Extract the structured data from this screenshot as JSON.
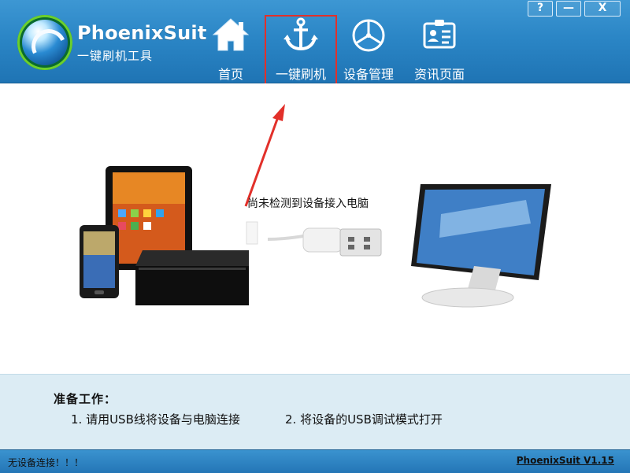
{
  "window": {
    "buttons": {
      "help": "?",
      "minimize": "—",
      "close": "X"
    }
  },
  "brand": {
    "name": "PhoenixSuit",
    "subtitle": "一键刷机工具"
  },
  "nav": [
    {
      "label": "首页",
      "icon": "home-icon"
    },
    {
      "label": "一键刷机",
      "icon": "anchor-icon",
      "selected": true
    },
    {
      "label": "设备管理",
      "icon": "aperture-icon"
    },
    {
      "label": "资讯页面",
      "icon": "id-card-icon"
    }
  ],
  "main": {
    "status_message": "尚未检测到设备接入电脑"
  },
  "preparation": {
    "title": "准备工作：",
    "step1": "1. 请用USB线将设备与电脑连接",
    "step2": "2. 将设备的USB调试模式打开"
  },
  "statusbar": {
    "connection": "无设备连接！！！",
    "version": "PhoenixSuit V1.15"
  },
  "colors": {
    "header_blue": "#2b86c6",
    "highlight_red": "#e2302a",
    "prep_bg": "#dcecf4"
  }
}
